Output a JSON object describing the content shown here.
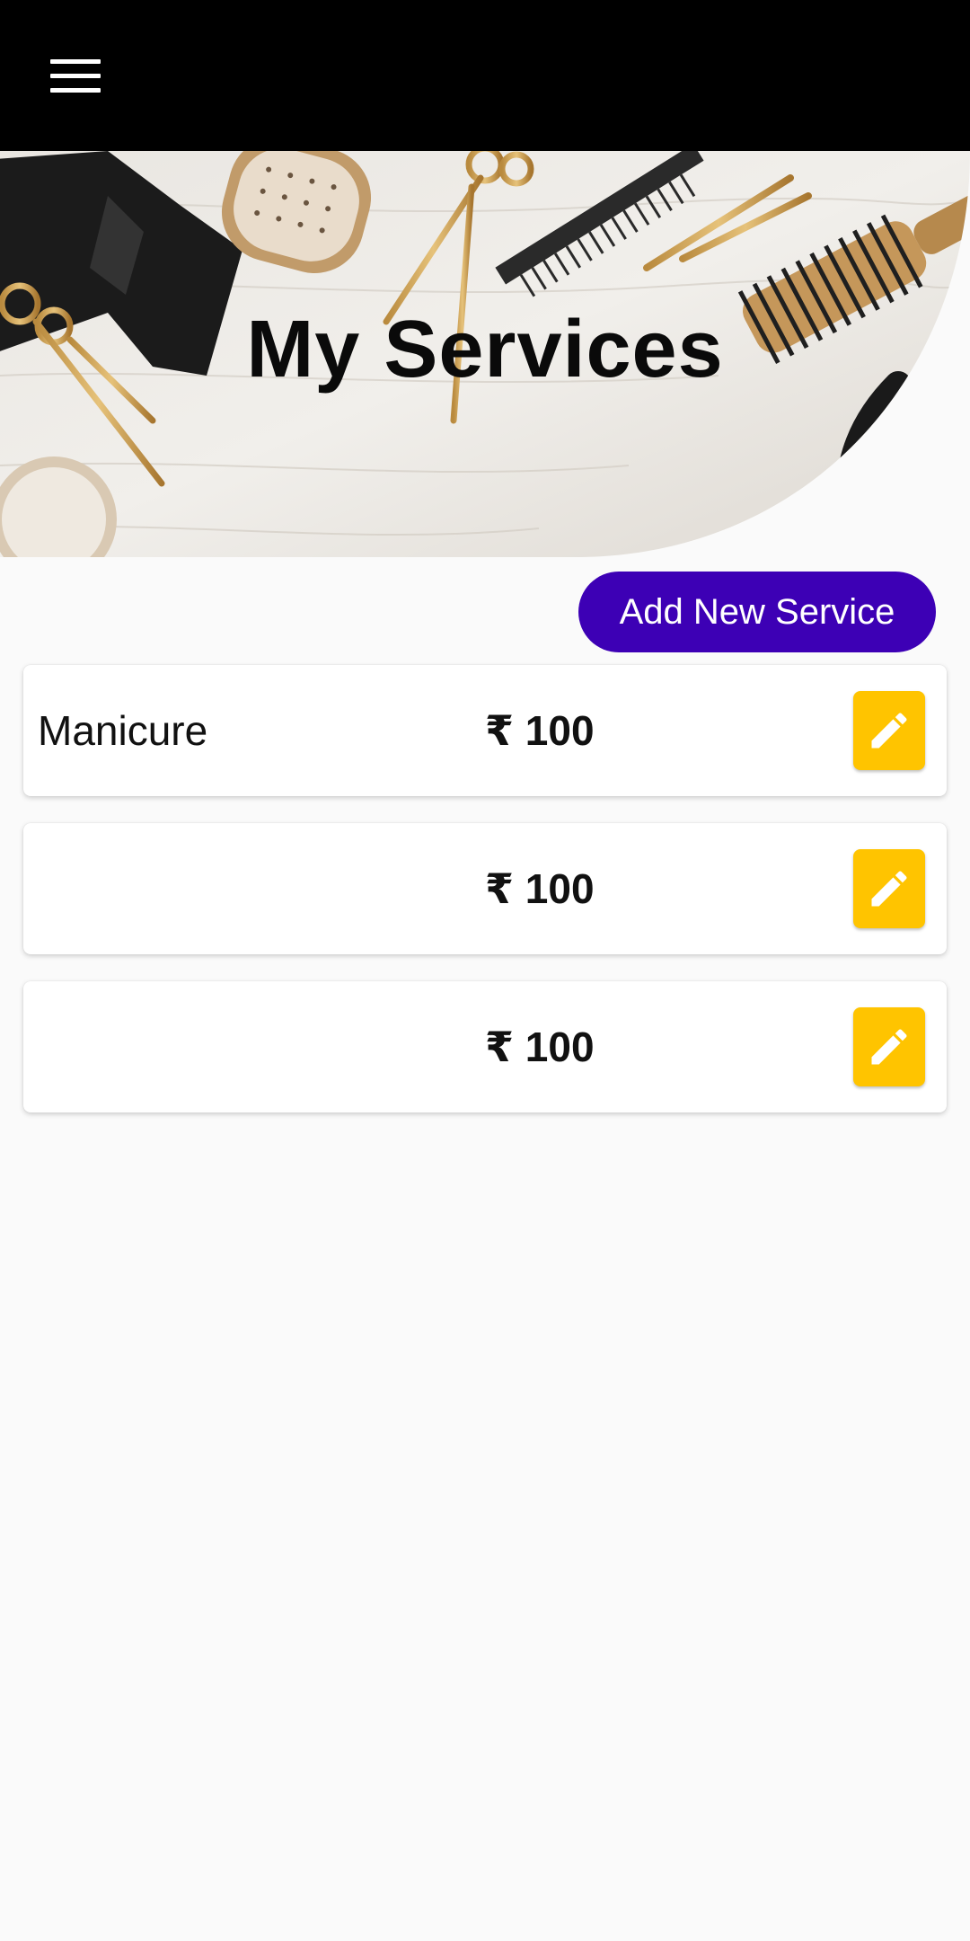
{
  "app_bar": {
    "menu_icon": "hamburger-menu-icon",
    "background": "#000000"
  },
  "hero": {
    "title": "My Services"
  },
  "actions": {
    "add_label": "Add New Service",
    "add_color": "#3d00b5"
  },
  "services": [
    {
      "name": "Manicure",
      "price": "₹ 100",
      "edit_icon": "pencil-icon"
    },
    {
      "name": "",
      "price": "₹ 100",
      "edit_icon": "pencil-icon"
    },
    {
      "name": "",
      "price": "₹ 100",
      "edit_icon": "pencil-icon"
    }
  ],
  "colors": {
    "edit_button": "#ffc400",
    "page_background": "#fafafa"
  }
}
